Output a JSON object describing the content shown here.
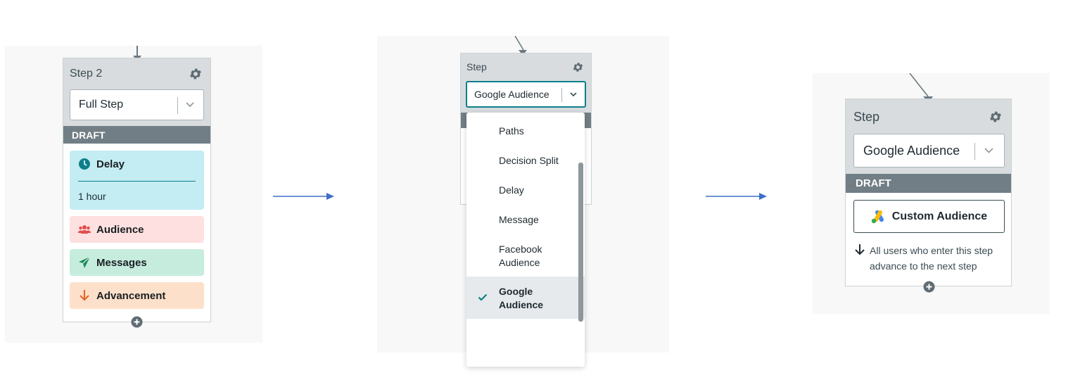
{
  "panel1": {
    "title": "Step 2",
    "select_value": "Full Step",
    "draft_label": "DRAFT",
    "delay": {
      "label": "Delay",
      "value": "1 hour"
    },
    "audience": {
      "label": "Audience"
    },
    "messages": {
      "label": "Messages"
    },
    "advancement": {
      "label": "Advancement"
    }
  },
  "panel2": {
    "title": "Step",
    "select_value": "Google Audience",
    "menu_items": [
      {
        "label": "Paths",
        "selected": false
      },
      {
        "label": "Decision Split",
        "selected": false
      },
      {
        "label": "Delay",
        "selected": false
      },
      {
        "label": "Message",
        "selected": false
      },
      {
        "label": "Facebook\nAudience",
        "selected": false
      },
      {
        "label": "Google\nAudience",
        "selected": true
      }
    ]
  },
  "panel3": {
    "title": "Step",
    "select_value": "Google Audience",
    "draft_label": "DRAFT",
    "custom_audience_label": "Custom Audience",
    "advance_text": "All users who enter this step advance to the next step"
  },
  "icons": {
    "gear": "gear-icon",
    "chevron": "chevron-down-icon",
    "clock": "clock-icon",
    "users": "users-icon",
    "paper_plane": "paper-plane-icon",
    "arrow_down": "arrow-down-icon",
    "plus": "plus-circle-icon",
    "check": "check-icon",
    "google_ads": "google-ads-icon"
  },
  "colors": {
    "delay_bg": "#c4ecf3",
    "audience_bg": "#fde0df",
    "messages_bg": "#c6ecdd",
    "advancement_bg": "#fde0ca",
    "draft_bg": "#717e85",
    "accent_teal": "#0d7f8a",
    "arrow_blue": "#3f6fc7"
  }
}
